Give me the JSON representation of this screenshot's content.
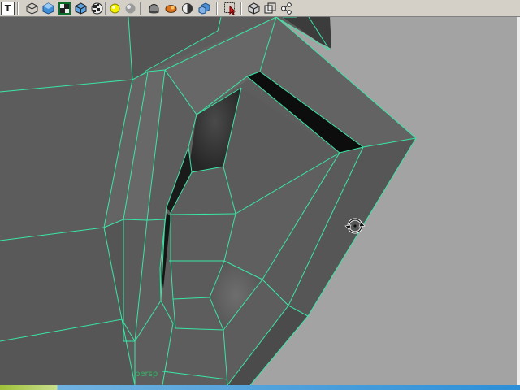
{
  "toolbar": {
    "buttons": [
      {
        "id": "text",
        "icon": "text-tool-icon",
        "label": "T"
      },
      {
        "id": "wireframe",
        "icon": "wireframe-cube-icon"
      },
      {
        "id": "smooth-shade",
        "icon": "smooth-shade-cube-icon"
      },
      {
        "id": "xray-active",
        "icon": "xray-texture-icon",
        "active": true
      },
      {
        "id": "shaded-wire",
        "icon": "shaded-wire-cube-icon"
      },
      {
        "id": "textured",
        "icon": "checker-texture-icon"
      },
      {
        "id": "default-light",
        "icon": "default-light-icon"
      },
      {
        "id": "all-lights",
        "icon": "sphere-light-icon"
      },
      {
        "id": "use-lights",
        "icon": "bowl-light-icon"
      },
      {
        "id": "shadows",
        "icon": "shadow-tool-icon"
      },
      {
        "id": "backface",
        "icon": "half-sphere-icon"
      },
      {
        "id": "isolate",
        "icon": "isolate-cube-icon"
      },
      {
        "id": "xray-select",
        "icon": "selection-arrow-icon"
      },
      {
        "id": "xray-box",
        "icon": "box-xray-icon"
      },
      {
        "id": "frame",
        "icon": "frame-all-icon"
      },
      {
        "id": "share",
        "icon": "share-nodes-icon"
      }
    ]
  },
  "viewport": {
    "camera_label": "persp",
    "wire_color": "#39e6a5",
    "cursor_icon": "orbit-cursor-icon"
  }
}
